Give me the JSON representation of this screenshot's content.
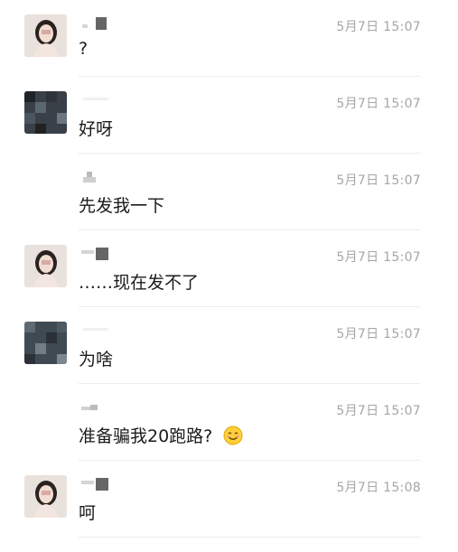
{
  "messages": [
    {
      "avatar": "female",
      "time": "5月7日 15:07",
      "text": "?"
    },
    {
      "avatar": "pixel-dark",
      "time": "5月7日 15:07",
      "text": "好呀"
    },
    {
      "avatar": "none",
      "time": "5月7日 15:07",
      "text": "先发我一下"
    },
    {
      "avatar": "female",
      "time": "5月7日 15:07",
      "text": "……现在发不了"
    },
    {
      "avatar": "pixel-dark",
      "time": "5月7日 15:07",
      "text": "为啥"
    },
    {
      "avatar": "none",
      "time": "5月7日 15:07",
      "text": "准备骗我20跑路?",
      "emoji": "smiling-face-emoji"
    },
    {
      "avatar": "female",
      "time": "5月7日 15:08",
      "text": "呵"
    }
  ],
  "colors": {
    "time": "#a6a6a6",
    "divider": "#ececec",
    "text": "#1b1b1b"
  }
}
